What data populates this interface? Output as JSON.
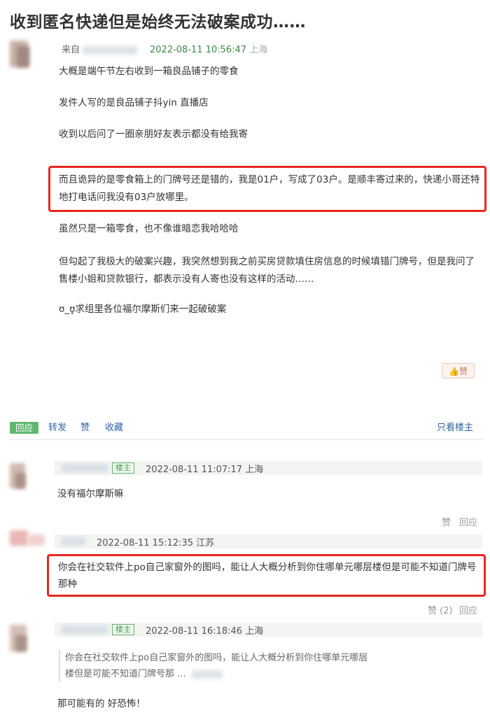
{
  "post": {
    "title": "收到匿名快递但是始终无法破案成功……",
    "from_label": "来自",
    "timestamp": "2022-08-11 10:56:47",
    "location": "上海",
    "paragraphs": [
      "大概是端午节左右收到一箱良品铺子的零食",
      "发件人写的是良品铺子抖yin 直播店",
      "收到以后问了一圈亲朋好友表示都没有给我寄",
      "而且诡异的是零食箱上的门牌号还是错的，我是01户，写成了03户。是顺丰寄过来的，快递小哥还特地打电话问我没有03户放哪里。",
      "虽然只是一箱零食，也不像谁暗恋我哈哈哈",
      "但勾起了我极大的破案兴趣，我突然想到我之前买房贷款填住房信息的时候填错门牌号，但是我问了售楼小姐和贷款银行，都表示没有人寄也没有这样的活动……",
      "ʊ_ʊ̥求组里各位福尔摩斯们来一起破破案"
    ],
    "like_label": "赞"
  },
  "actions": {
    "reply": "回应",
    "forward": "转发",
    "like": "赞",
    "collect": "收藏",
    "only_op": "只看楼主"
  },
  "comments": [
    {
      "op_badge": "楼主",
      "timestamp": "2022-08-11 11:07:17",
      "location": "上海",
      "text": "没有福尔摩斯嘛",
      "like_label": "赞",
      "reply_label": "回应"
    },
    {
      "timestamp": "2022-08-11 15:12:35",
      "location": "江苏",
      "text": "你会在社交软件上po自己家窗外的图吗，能让人大概分析到你住哪单元哪层楼但是可能不知道门牌号那种",
      "like_label": "赞 (2)",
      "reply_label": "回应"
    },
    {
      "op_badge": "楼主",
      "timestamp": "2022-08-11 16:18:46",
      "location": "上海",
      "quote": "你会在社交软件上po自己家窗外的图吗，能让人大概分析到你住哪单元哪层楼但是可能不知道门牌号那 ...",
      "text": "那可能有的 好恐怖！"
    }
  ],
  "colors": {
    "accent_red": "#e8261f",
    "link_blue": "#31629e",
    "op_green": "#62b66f"
  }
}
